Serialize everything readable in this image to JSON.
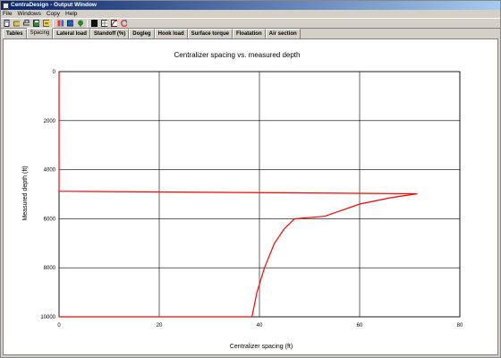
{
  "window": {
    "title": "CentraDesign - Output Window"
  },
  "menu": [
    "File",
    "Windows",
    "Copy",
    "Help"
  ],
  "toolbar": {
    "icons": [
      "new-icon",
      "open-icon",
      "print-icon",
      "save-icon",
      "export-icon",
      "color-icon",
      "chart-icon",
      "tree-icon",
      "monitor-icon",
      "grid-icon",
      "curve-icon",
      "color-wheel-icon"
    ]
  },
  "tabs": [
    "Tables",
    "Spacing",
    "Lateral load",
    "Standoff (%)",
    "Dogleg",
    "Hook load",
    "Surface torque",
    "Floatation",
    "Air section"
  ],
  "active_tab": "Spacing",
  "colors": {
    "series": "#ff0000",
    "grid": "#000000"
  },
  "chart_data": {
    "type": "line",
    "title": "Centralizer spacing vs. measured depth",
    "xlabel": "Centralizer spacing (ft)",
    "ylabel": "Measured depth (ft)",
    "xlim": [
      0,
      80
    ],
    "ylim": [
      0,
      10000
    ],
    "y_inverted": true,
    "xticks": [
      0,
      20,
      40,
      60,
      80
    ],
    "yticks": [
      0,
      2000,
      4000,
      6000,
      8000,
      10000
    ],
    "grid": true,
    "series": [
      {
        "values": [
          {
            "x": 0,
            "y": 10000
          },
          {
            "x": 38.5,
            "y": 10000
          },
          {
            "x": 39.5,
            "y": 9000
          },
          {
            "x": 41,
            "y": 8000
          },
          {
            "x": 43,
            "y": 7000
          },
          {
            "x": 45,
            "y": 6400
          },
          {
            "x": 47,
            "y": 6000
          },
          {
            "x": 53,
            "y": 5900
          },
          {
            "x": 60,
            "y": 5400
          },
          {
            "x": 66,
            "y": 5150
          },
          {
            "x": 71.5,
            "y": 4980
          },
          {
            "x": 0,
            "y": 4880
          },
          {
            "x": 0,
            "y": 0
          }
        ]
      }
    ]
  }
}
